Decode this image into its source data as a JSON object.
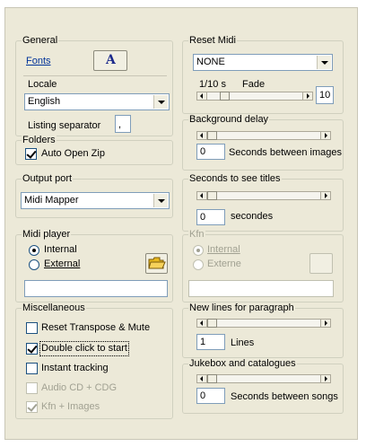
{
  "close_icon": "close-x-icon",
  "general": {
    "title": "General",
    "fonts_label": "Fonts",
    "fonts_button_glyph": "A",
    "locale_label": "Locale",
    "locale_value": "English",
    "listing_separator_label": "Listing separator",
    "listing_separator_value": ","
  },
  "folders": {
    "title": "Folders",
    "auto_open_zip_label": "Auto Open Zip",
    "auto_open_zip_checked": true
  },
  "output_port": {
    "title": "Output port",
    "value": "Midi Mapper"
  },
  "midi_player": {
    "title": "Midi player",
    "internal_label": "Internal",
    "external_label": "External",
    "selected": "Internal",
    "browse_icon": "folder-open-icon",
    "path_value": ""
  },
  "misc": {
    "title": "Miscellaneous",
    "items": [
      {
        "label": "Reset Transpose & Mute",
        "checked": false,
        "enabled": true
      },
      {
        "label": "Double click to start",
        "checked": true,
        "enabled": true
      },
      {
        "label": "Instant tracking",
        "checked": false,
        "enabled": true
      },
      {
        "label": "Audio CD + CDG",
        "checked": false,
        "enabled": false
      },
      {
        "label": "Kfn + Images",
        "checked": true,
        "enabled": false
      }
    ]
  },
  "reset_midi": {
    "title": "Reset Midi",
    "value": "NONE",
    "rate_label": "1/10 s",
    "fade_label": "Fade",
    "fade_value": "10",
    "fade_slider_fraction": 0.15
  },
  "background_delay": {
    "title": "Background delay",
    "value": "0",
    "unit_label": "Seconds between images",
    "slider_fraction": 0.0
  },
  "seconds_titles": {
    "title": "Seconds to see titles",
    "value": "0",
    "unit_label": "secondes",
    "slider_fraction": 0.0
  },
  "kfn": {
    "title": "Kfn",
    "internal_label": "Internal",
    "external_label": "Externe",
    "selected": "Internal",
    "path_value": ""
  },
  "new_lines": {
    "title": "New lines for paragraph",
    "value": "1",
    "unit_label": "Lines",
    "slider_fraction": 0.0
  },
  "jukebox": {
    "title": "Jukebox and catalogues",
    "value": "0",
    "unit_label": "Seconds between songs",
    "slider_fraction": 0.0
  },
  "colors": {
    "panel": "#ece9d8",
    "field_border": "#7f9db9",
    "disabled_text": "#a1a192",
    "font_button_letter": "#1c2a8c"
  }
}
